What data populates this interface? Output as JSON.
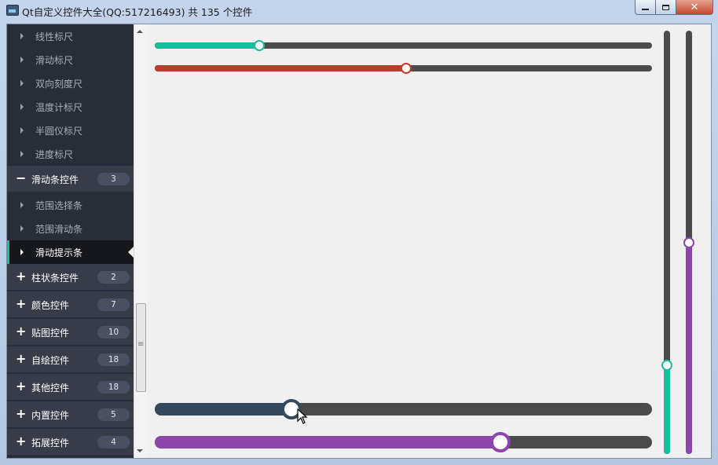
{
  "window": {
    "title": "Qt自定义控件大全(QQ:517216493) 共 135 个控件",
    "close_glyph": "✕"
  },
  "sidebar": {
    "scroll_grip": "≡",
    "children_above": [
      "线性标尺",
      "滑动标尺",
      "双向刻度尺",
      "温度计标尺",
      "半圆仪标尺",
      "进度标尺"
    ],
    "expanded_group": {
      "sign": "−",
      "label": "滑动条控件",
      "count": "3"
    },
    "expanded_children": [
      "范围选择条",
      "范围滑动条",
      "滑动提示条"
    ],
    "active_child": "滑动提示条",
    "groups": [
      {
        "sign": "+",
        "label": "柱状条控件",
        "count": "2"
      },
      {
        "sign": "+",
        "label": "颜色控件",
        "count": "7"
      },
      {
        "sign": "+",
        "label": "贴图控件",
        "count": "10"
      },
      {
        "sign": "+",
        "label": "自绘控件",
        "count": "18"
      },
      {
        "sign": "+",
        "label": "其他控件",
        "count": "18"
      },
      {
        "sign": "+",
        "label": "内置控件",
        "count": "5"
      },
      {
        "sign": "+",
        "label": "拓展控件",
        "count": "4"
      }
    ]
  },
  "colors": {
    "teal": "#1abc9c",
    "red": "#c0392b",
    "purple": "#8e44ad",
    "dark": "#34495e",
    "track": "#4b4b4b"
  },
  "sliders": {
    "h_teal_value": 0.21,
    "h_red_value": 0.505,
    "h_dark_value": 0.275,
    "h_purple_value": 0.695,
    "v_teal_value": 0.21,
    "v_purple_value": 0.5
  }
}
